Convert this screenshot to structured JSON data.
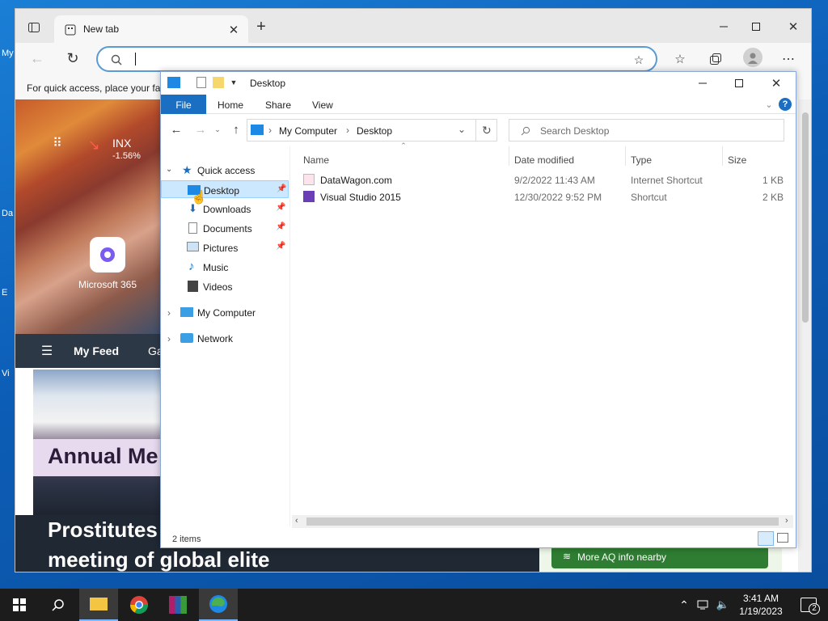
{
  "desktop": {
    "icon_labels": [
      "My",
      "Da",
      "E",
      "Vi"
    ]
  },
  "browser": {
    "tab_title": "New tab",
    "favorites_hint": "For quick access, place your fa",
    "hero": {
      "ticker": "INX",
      "change": "-1.56%",
      "app_label": "Microsoft 365"
    },
    "feed": {
      "my_feed": "My Feed",
      "next_tab": "Ga"
    },
    "news": {
      "banner_text": "Annual Me",
      "headline_line1": "Prostitutes",
      "headline_line2": "meeting of global elite"
    },
    "aq_button": "More AQ info nearby"
  },
  "explorer": {
    "title": "Desktop",
    "ribbon_tabs": [
      "File",
      "Home",
      "Share",
      "View"
    ],
    "breadcrumb": [
      "My Computer",
      "Desktop"
    ],
    "search_placeholder": "Search Desktop",
    "nav": {
      "quick_access": "Quick access",
      "items": [
        "Desktop",
        "Downloads",
        "Documents",
        "Pictures",
        "Music",
        "Videos"
      ],
      "my_computer": "My Computer",
      "network": "Network"
    },
    "columns": [
      "Name",
      "Date modified",
      "Type",
      "Size"
    ],
    "files": [
      {
        "name": "DataWagon.com",
        "date": "9/2/2022 11:43 AM",
        "type": "Internet Shortcut",
        "size": "1 KB"
      },
      {
        "name": "Visual Studio 2015",
        "date": "12/30/2022 9:52 PM",
        "type": "Shortcut",
        "size": "2 KB"
      }
    ],
    "status": "2 items"
  },
  "taskbar": {
    "time": "3:41 AM",
    "date": "1/19/2023",
    "notifications": "2"
  },
  "colors": {
    "accent": "#1a6fc3",
    "selection": "#cce8ff",
    "taskbar": "#1c1c1c"
  }
}
